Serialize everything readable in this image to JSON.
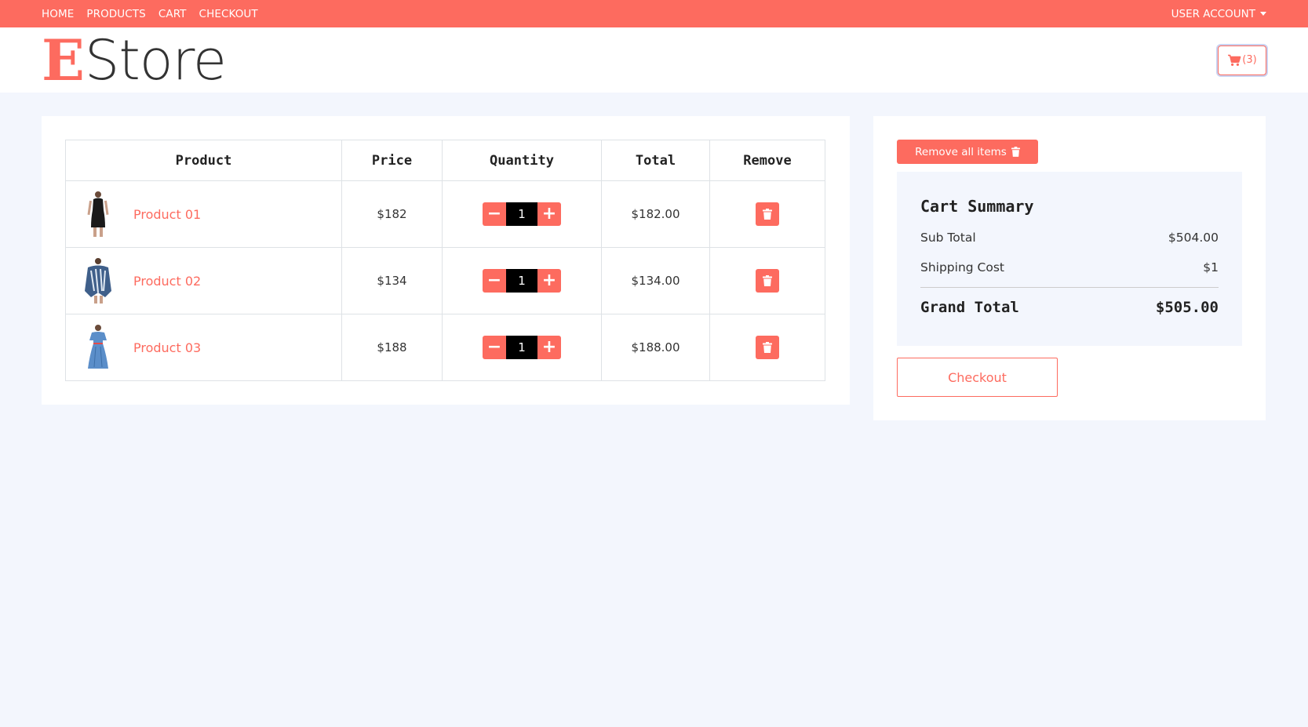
{
  "nav": {
    "links": [
      "HOME",
      "PRODUCTS",
      "CART",
      "CHECKOUT"
    ],
    "account": "USER ACCOUNT"
  },
  "brand": {
    "logo_initial": "E",
    "logo_rest": "Store",
    "accent": "#fd6b5f"
  },
  "header": {
    "cart_count": "(3)"
  },
  "table": {
    "headers": [
      "Product",
      "Price",
      "Quantity",
      "Total",
      "Remove"
    ],
    "rows": [
      {
        "name": "Product 01",
        "price": "$182",
        "qty": "1",
        "total": "$182.00"
      },
      {
        "name": "Product 02",
        "price": "$134",
        "qty": "1",
        "total": "$134.00"
      },
      {
        "name": "Product 03",
        "price": "$188",
        "qty": "1",
        "total": "$188.00"
      }
    ]
  },
  "sidebar": {
    "remove_all": "Remove all items",
    "summary_title": "Cart Summary",
    "subtotal_label": "Sub Total",
    "subtotal": "$504.00",
    "shipping_label": "Shipping Cost",
    "shipping": "$1",
    "grand_label": "Grand Total",
    "grand": "$505.00",
    "checkout": "Checkout"
  }
}
